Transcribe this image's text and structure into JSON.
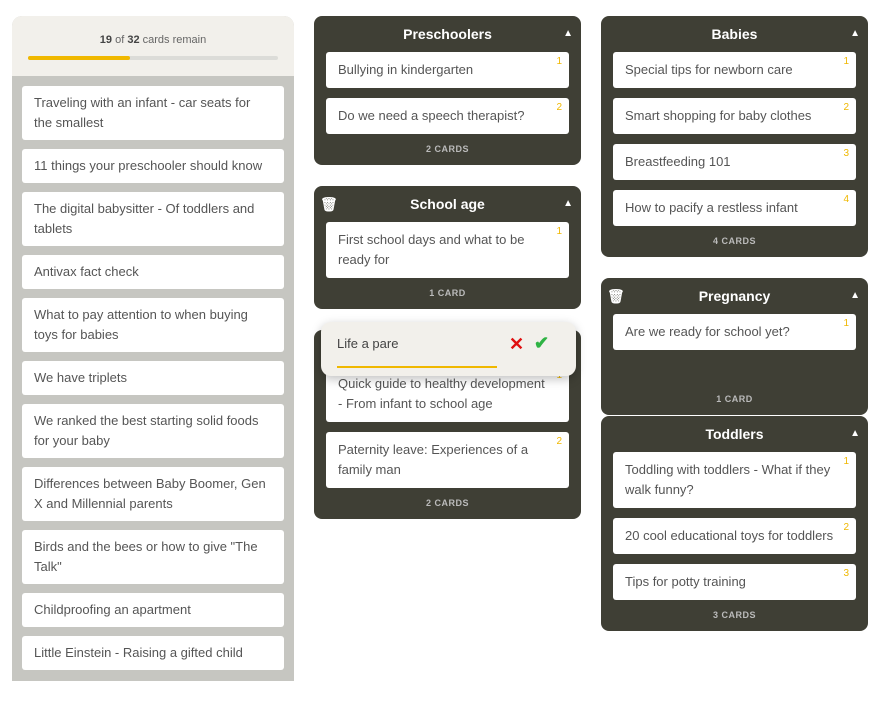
{
  "progress": {
    "remaining": "19",
    "of": "of",
    "total": "32",
    "suffix": "cards remain",
    "fraction": 0.40625
  },
  "unassigned": [
    "Traveling with an infant - car seats for the smallest",
    "11 things your preschooler should know",
    "The digital babysitter - Of toddlers and tablets",
    "Antivax fact check",
    "What to pay attention to when buying toys for babies",
    "We have triplets",
    "We ranked the best starting solid foods for your baby",
    "Differences between Baby Boomer, Gen X and Millennial parents",
    "Birds and the bees or how to give \"The Talk\"",
    "Childproofing an apartment",
    "Little Einstein - Raising a gifted child"
  ],
  "groups": [
    {
      "title": "Preschoolers",
      "trash": false,
      "cards": [
        "Bullying in kindergarten",
        "Do we need a speech therapist?"
      ],
      "footer": "2 CARDS"
    },
    {
      "title": "School age",
      "trash": true,
      "cards": [
        "First school days and what to be ready for"
      ],
      "footer": "1 CARD"
    },
    {
      "title": "",
      "trash": false,
      "cards": [
        "Quick guide to healthy development - From infant to school age",
        "Paternity leave: Experiences of a family man"
      ],
      "footer": "2 CARDS"
    },
    {
      "title": "Babies",
      "trash": false,
      "cards": [
        "Special tips for newborn care",
        "Smart shopping for baby clothes",
        "Breastfeeding 101",
        "How to pacify a restless infant"
      ],
      "footer": "4 CARDS"
    },
    {
      "title": "Pregnancy",
      "trash": true,
      "cards": [
        "Are we ready for school yet?"
      ],
      "footer": "1 CARD"
    },
    {
      "title": "Toddlers",
      "trash": false,
      "cards": [
        "Toddling with toddlers - What if they walk funny?",
        "20 cool educational toys for toddlers",
        "Tips for potty training"
      ],
      "footer": "3 CARDS"
    }
  ],
  "edit": {
    "value": "Life a pare"
  },
  "colors": {
    "accent": "#f0b800",
    "group_bg": "#3f3f35",
    "cancel": "#e01010",
    "confirm": "#2fb344"
  }
}
